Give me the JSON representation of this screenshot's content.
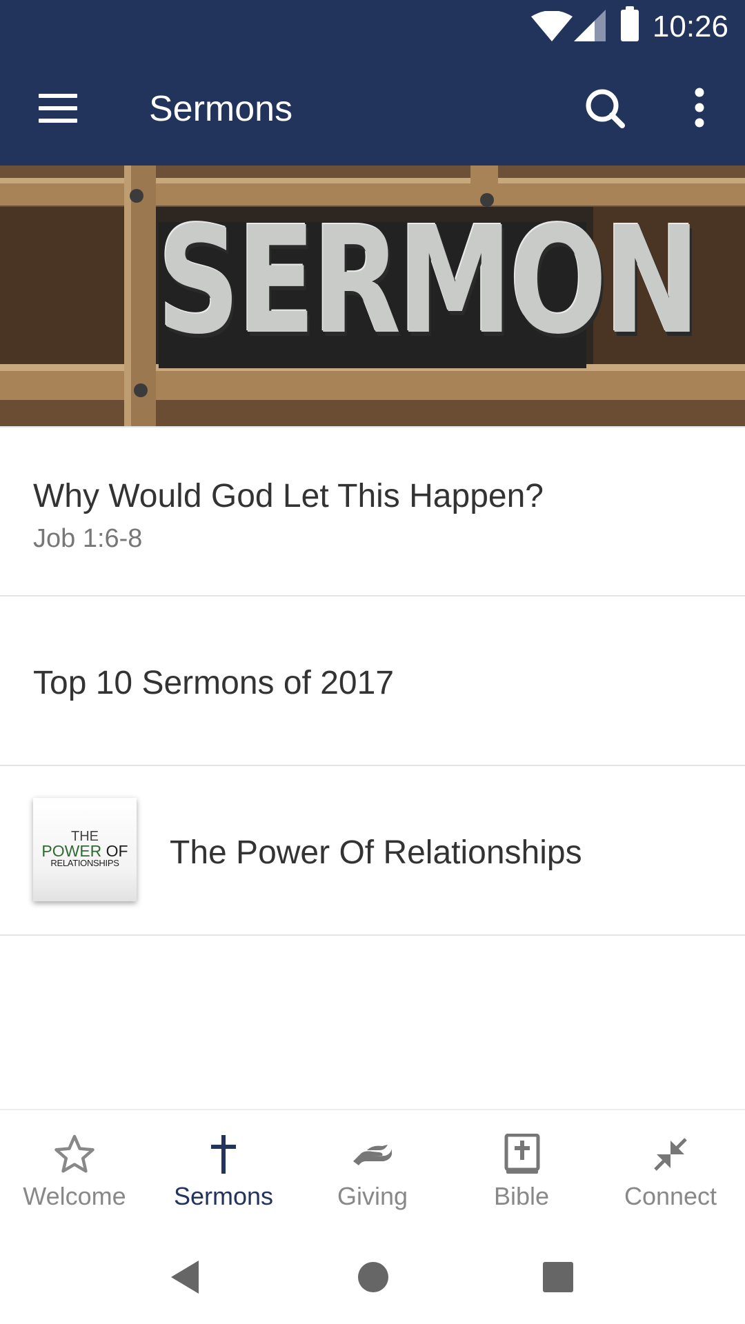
{
  "status_bar": {
    "time": "10:26",
    "icons": [
      "wifi-icon",
      "signal-icon",
      "battery-icon"
    ]
  },
  "app_bar": {
    "title": "Sermons",
    "icons": [
      "menu-icon",
      "search-icon",
      "more-vert-icon"
    ]
  },
  "hero": {
    "image_text": "SERMON"
  },
  "list": {
    "items": [
      {
        "title": "Why Would God Let This Happen?",
        "subtitle": "Job 1:6-8"
      },
      {
        "title": "Top 10 Sermons of 2017"
      },
      {
        "title": "The Power Of Relationships",
        "thumbnail": {
          "line1": "THE",
          "line2_a": "POWER",
          "line2_b": "OF",
          "line3": "RELATIONSHIPS"
        }
      }
    ]
  },
  "bottom_nav": {
    "items": [
      {
        "label": "Welcome",
        "icon": "star-icon"
      },
      {
        "label": "Sermons",
        "icon": "cross-icon",
        "active": true
      },
      {
        "label": "Giving",
        "icon": "giving-hand-icon"
      },
      {
        "label": "Bible",
        "icon": "bible-icon"
      },
      {
        "label": "Connect",
        "icon": "connect-arrows-icon"
      }
    ]
  },
  "colors": {
    "primary": "#22335c",
    "active_tab": "#22335c",
    "inactive_tab": "#888888",
    "divider": "#e4e4e4"
  }
}
